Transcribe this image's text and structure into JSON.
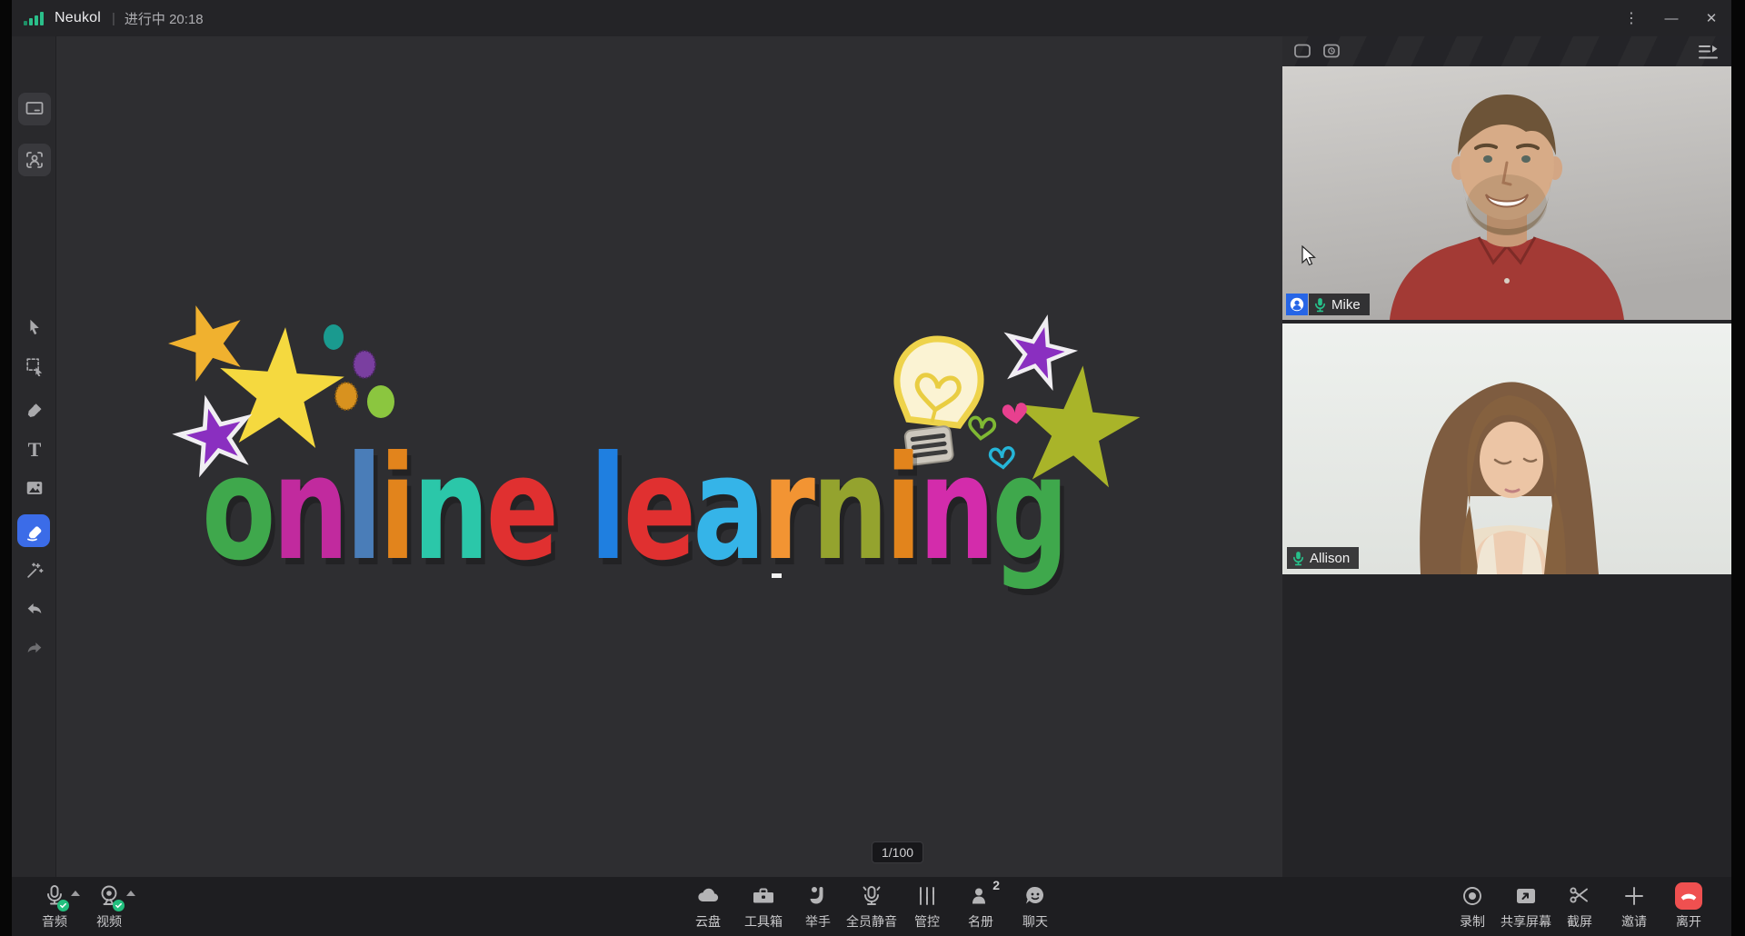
{
  "topbar": {
    "app_name": "Neukol",
    "separator": "|",
    "meeting_status": "进行中 20:18",
    "window_controls": {
      "more": "⋮",
      "minimize": "—",
      "close": "✕"
    }
  },
  "sidebar": {
    "text_tool_glyph": "T",
    "active_tool": "eraser",
    "active_tool_color": "#3b6ce8"
  },
  "canvas": {
    "page_indicator": "1/100",
    "artwork_text": "online learning",
    "art": {
      "letters": [
        {
          "ch": "o",
          "color": "#3fa84c"
        },
        {
          "ch": "n",
          "color": "#c12a9e"
        },
        {
          "ch": "l",
          "color": "#4a7db8"
        },
        {
          "ch": "i",
          "color": "#e2841c"
        },
        {
          "ch": "n",
          "color": "#2bc7a9"
        },
        {
          "ch": "e",
          "color": "#e03030"
        },
        {
          "ch": " ",
          "color": ""
        },
        {
          "ch": "l",
          "color": "#1f7fe0"
        },
        {
          "ch": "e",
          "color": "#e03030"
        },
        {
          "ch": "a",
          "color": "#35b4e8"
        },
        {
          "ch": "r",
          "color": "#f29433"
        },
        {
          "ch": "n",
          "color": "#94a32e"
        },
        {
          "ch": "i",
          "color": "#e2841c"
        },
        {
          "ch": "n",
          "color": "#d32cab"
        },
        {
          "ch": "g",
          "color": "#3fa84c"
        }
      ]
    }
  },
  "panel": {
    "participants": [
      {
        "name": "Mike",
        "is_host": true,
        "mic_on": true
      },
      {
        "name": "Allison",
        "is_host": false,
        "mic_on": true
      }
    ]
  },
  "bottom_toolbar": {
    "left": [
      {
        "id": "audio",
        "label": "音频"
      },
      {
        "id": "video",
        "label": "视频"
      }
    ],
    "center": [
      {
        "id": "cloud-drive",
        "label": "云盘"
      },
      {
        "id": "toolbox",
        "label": "工具箱"
      },
      {
        "id": "raise-hand",
        "label": "举手"
      },
      {
        "id": "mute-all",
        "label": "全员静音"
      },
      {
        "id": "control",
        "label": "管控"
      },
      {
        "id": "roster",
        "label": "名册",
        "badge": "2"
      },
      {
        "id": "chat",
        "label": "聊天"
      }
    ],
    "right": [
      {
        "id": "record",
        "label": "录制"
      },
      {
        "id": "share-screen",
        "label": "共享屏幕"
      },
      {
        "id": "screenshot",
        "label": "截屏"
      },
      {
        "id": "invite",
        "label": "邀请"
      },
      {
        "id": "leave",
        "label": "离开"
      }
    ]
  },
  "colors": {
    "accent_blue": "#3b6ce8",
    "mic_green": "#27c08a",
    "check_green": "#23bf7e",
    "leave_red": "#ef5050",
    "host_badge_blue": "#2665e6"
  }
}
